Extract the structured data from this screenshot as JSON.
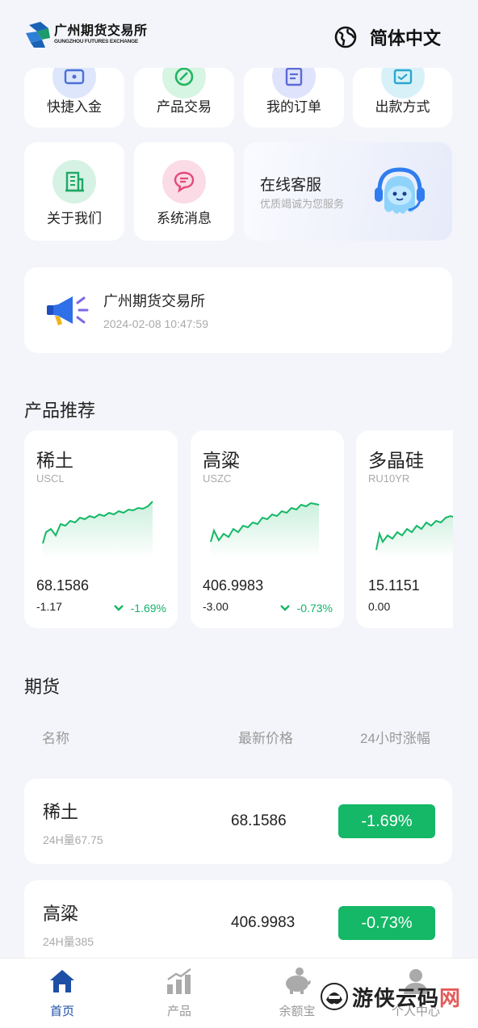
{
  "header": {
    "logo_cn": "广州期货交易所",
    "logo_en": "GUNGZHOU FUTURES EXCHANGE",
    "language": "简体中文"
  },
  "quick_menu": [
    {
      "label": "快捷入金",
      "icon": "wallet-icon"
    },
    {
      "label": "产品交易",
      "icon": "trade-icon"
    },
    {
      "label": "我的订单",
      "icon": "order-icon"
    },
    {
      "label": "出款方式",
      "icon": "card-icon"
    },
    {
      "label": "关于我们",
      "icon": "building-icon"
    },
    {
      "label": "系统消息",
      "icon": "message-icon"
    }
  ],
  "service": {
    "title": "在线客服",
    "subtitle": "优质竭诚为您服务"
  },
  "notice": {
    "title": "广州期货交易所",
    "time": "2024-02-08 10:47:59"
  },
  "recommend": {
    "title": "产品推荐",
    "items": [
      {
        "name": "稀土",
        "code": "USCL",
        "price": "68.1586",
        "change": "-1.17",
        "pct": "-1.69%"
      },
      {
        "name": "高粱",
        "code": "USZC",
        "price": "406.9983",
        "change": "-3.00",
        "pct": "-0.73%"
      },
      {
        "name": "多晶硅",
        "code": "RU10YR",
        "price": "15.1151",
        "change": "0.00",
        "pct": ""
      }
    ]
  },
  "futures": {
    "title": "期货",
    "col_name": "名称",
    "col_price": "最新价格",
    "col_change": "24小时涨幅",
    "rows": [
      {
        "name": "稀土",
        "volume": "24H量67.75",
        "price": "68.1586",
        "pct": "-1.69%"
      },
      {
        "name": "高粱",
        "volume": "24H量385",
        "price": "406.9983",
        "pct": "-0.73%"
      }
    ]
  },
  "tabbar": [
    {
      "label": "首页",
      "icon": "home-icon",
      "active": true
    },
    {
      "label": "产品",
      "icon": "chart-bars-icon",
      "active": false
    },
    {
      "label": "余额宝",
      "icon": "piggy-bank-icon",
      "active": false
    },
    {
      "label": "个人中心",
      "icon": "user-icon",
      "active": false
    }
  ],
  "watermark": {
    "text": "游侠云码",
    "last": "网"
  },
  "colors": {
    "accent_green": "#14b866",
    "active_blue": "#1d4fa6"
  }
}
